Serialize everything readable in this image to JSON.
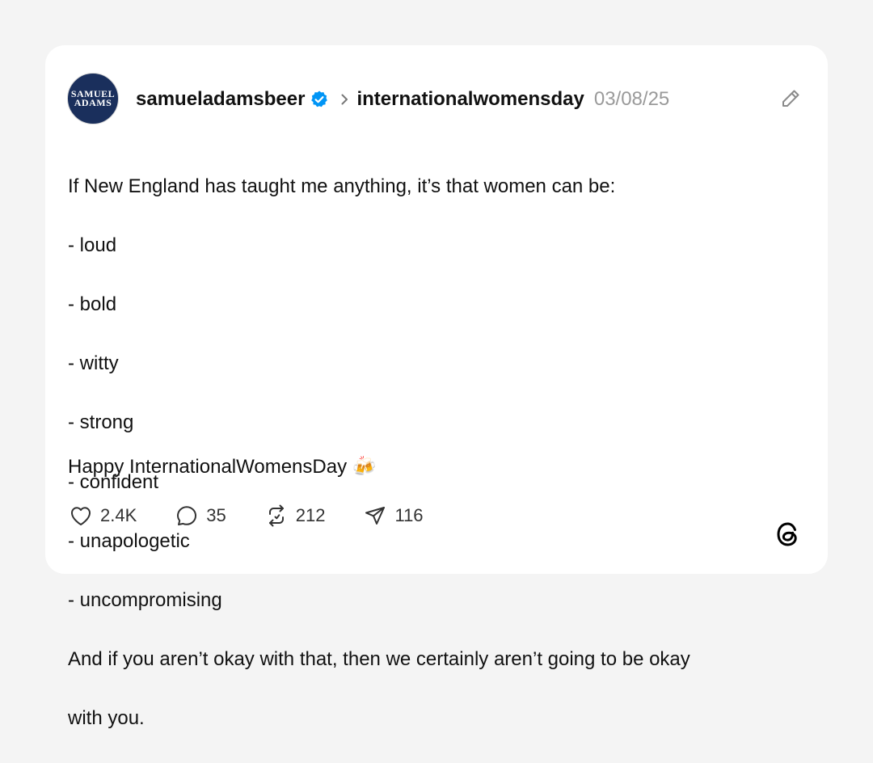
{
  "post": {
    "avatar_text": "SAMUEL\nADAMS",
    "username": "samueladamsbeer",
    "community": "internationalwomensday",
    "date": "03/08/25",
    "body_lines": [
      "If New England has taught me anything, it’s that women can be:",
      "- loud",
      "- bold",
      "- witty",
      "- strong",
      "- confident",
      "- unapologetic",
      "- uncompromising",
      "And if you aren’t okay with that, then we certainly aren’t going to be okay",
      "with you."
    ],
    "closing_text": "Happy InternationalWomensDay",
    "closing_emoji": "🍻"
  },
  "actions": {
    "likes": "2.4K",
    "replies": "35",
    "reposts": "212",
    "shares": "116"
  },
  "icons": {
    "verified": "verified-badge-icon",
    "chevron": "chevron-right-icon",
    "edit": "pencil-icon",
    "like": "heart-icon",
    "reply": "comment-icon",
    "repost": "repost-icon",
    "share": "send-icon",
    "brand": "threads-logo-icon"
  },
  "colors": {
    "page_background": "#f4f4f4",
    "card_background": "#ffffff",
    "verified_blue": "#0095f6",
    "avatar_navy": "#1a2f5c",
    "muted_text": "#9a9a9a"
  }
}
